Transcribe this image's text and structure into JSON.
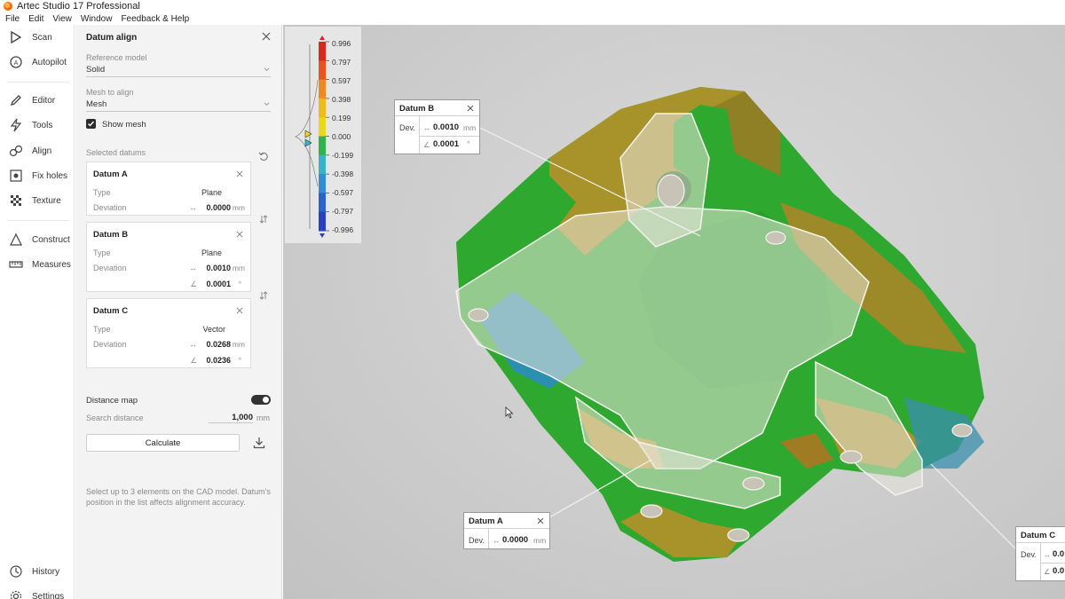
{
  "app": {
    "title": "Artec Studio 17 Professional"
  },
  "menu": [
    "File",
    "Edit",
    "View",
    "Window",
    "Feedback & Help"
  ],
  "rail": {
    "scan": "Scan",
    "autopilot": "Autopilot",
    "editor": "Editor",
    "tools": "Tools",
    "align": "Align",
    "fix_holes": "Fix holes",
    "texture": "Texture",
    "construct": "Construct",
    "measures": "Measures",
    "history": "History",
    "settings": "Settings"
  },
  "panel": {
    "title": "Datum align",
    "reference_model_label": "Reference model",
    "reference_model_value": "Solid",
    "mesh_to_align_label": "Mesh to align",
    "mesh_to_align_value": "Mesh",
    "show_mesh_label": "Show mesh",
    "show_mesh_checked": true,
    "selected_datums_label": "Selected datums",
    "datums": [
      {
        "name": "Datum A",
        "type_label": "Type",
        "type": "Plane",
        "deviation_label": "Deviation",
        "distance": "0.0000",
        "distance_unit": "mm"
      },
      {
        "name": "Datum B",
        "type_label": "Type",
        "type": "Plane",
        "deviation_label": "Deviation",
        "distance": "0.0010",
        "distance_unit": "mm",
        "angle": "0.0001",
        "angle_unit": "°"
      },
      {
        "name": "Datum C",
        "type_label": "Type",
        "type": "Vector",
        "deviation_label": "Deviation",
        "distance": "0.0268",
        "distance_unit": "mm",
        "angle": "0.0236",
        "angle_unit": "°"
      }
    ],
    "distance_map_label": "Distance map",
    "distance_map_on": true,
    "search_distance_label": "Search distance",
    "search_distance_value": "1,000",
    "search_distance_unit": "mm",
    "calculate_label": "Calculate",
    "hint": "Select up to 3 elements on the CAD model. Datum's position in the list affects alignment accuracy."
  },
  "colorbar": {
    "ticks": [
      "0.996",
      "0.797",
      "0.597",
      "0.398",
      "0.199",
      "0.000",
      "-0.199",
      "-0.398",
      "-0.597",
      "-0.797",
      "-0.996"
    ],
    "colors": [
      "#d42a1e",
      "#e6531c",
      "#f08a1c",
      "#f2b81e",
      "#e8d61f",
      "#2fb34a",
      "#35b5c8",
      "#2f8fd6",
      "#2a62d0",
      "#2640c4"
    ]
  },
  "callouts": [
    {
      "name": "Datum B",
      "dev_label": "Dev.",
      "distance": "0.0010",
      "distance_unit": "mm",
      "angle": "0.0001",
      "angle_unit": "°"
    },
    {
      "name": "Datum A",
      "dev_label": "Dev.",
      "distance": "0.0000",
      "distance_unit": "mm"
    },
    {
      "name": "Datum C",
      "dev_label": "Dev.",
      "distance": "0.0",
      "angle": "0.0"
    }
  ],
  "colors": {
    "deviation_green": "#2ea82f",
    "deviation_olive": "#a8922a",
    "deviation_cyan": "#2d8fb0",
    "cad_overlay": "#eae6dc"
  }
}
